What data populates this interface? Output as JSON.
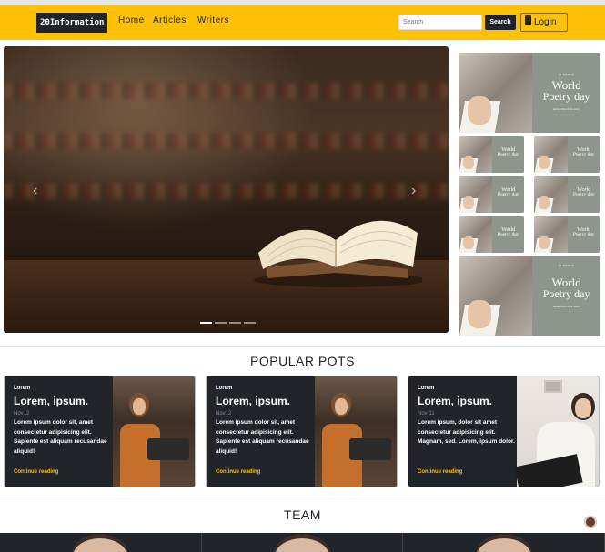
{
  "navbar": {
    "brand": "20Information",
    "links": [
      "Home",
      "Articles",
      "Writers"
    ],
    "search_placeholder": "Search",
    "search_button": "Search",
    "login": "Login",
    "color": "#ffc107"
  },
  "carousel": {
    "slides": 4,
    "active_slide": 1
  },
  "thumbnails": {
    "poster_top": "21 MARCH",
    "poster_line1": "World",
    "poster_line2": "Poetry day",
    "poster_url": "www.infoclick.com"
  },
  "popular": {
    "title": "POPULAR POTS",
    "cards": [
      {
        "label": "Lorem",
        "title": "Lorem, ipsum.",
        "date": "Nov12",
        "text": "Lorem ipsum dolor sit, amet consectetur adipisicing elit. Sapiente est aliquam recusandae aliquid!",
        "more": "Continue reading"
      },
      {
        "label": "Lorem",
        "title": "Lorem, ipsum.",
        "date": "Nov12",
        "text": "Lorem ipsum dolor sit, amet consectetur adipisicing elit. Sapiente est aliquam recusandae aliquid!",
        "more": "Continue reading"
      },
      {
        "label": "Lorem",
        "title": "Lorem, ipsum.",
        "date": "Nov 11",
        "text": "Lorem ipsum, dolor sit amet consectetur adipisicing elit. Magnam, sed. Lorem, ipsum dolor.",
        "more": "Continue reading"
      }
    ]
  },
  "team": {
    "title": "TEAM"
  }
}
